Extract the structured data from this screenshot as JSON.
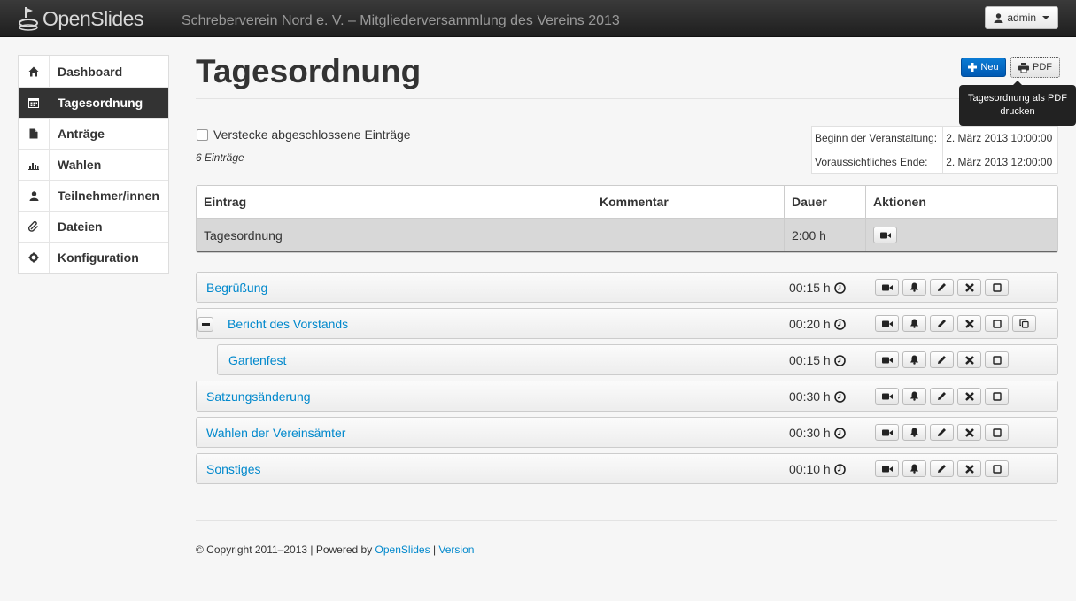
{
  "header": {
    "logo_text": "OpenSlides",
    "event_title": "Schreberverein Nord e. V. – Mitgliederversammlung des Vereins 2013",
    "user_label": "admin"
  },
  "sidebar": {
    "items": [
      {
        "label": "Dashboard",
        "icon": "home-icon"
      },
      {
        "label": "Tagesordnung",
        "icon": "calendar-icon",
        "active": true
      },
      {
        "label": "Anträge",
        "icon": "file-icon"
      },
      {
        "label": "Wahlen",
        "icon": "bar-chart-icon"
      },
      {
        "label": "Teilnehmer/innen",
        "icon": "user-icon"
      },
      {
        "label": "Dateien",
        "icon": "paperclip-icon"
      },
      {
        "label": "Konfiguration",
        "icon": "cog-icon"
      }
    ]
  },
  "main": {
    "title": "Tagesordnung",
    "new_button": "Neu",
    "pdf_button": "PDF",
    "pdf_tooltip": "Tagesordnung als PDF drucken",
    "hide_closed_label": "Verstecke abgeschlossene Einträge",
    "entry_count": "6 Einträge",
    "event_info": {
      "start_label": "Beginn der Veranstaltung:",
      "start_value": "2. März 2013 10:00:00",
      "end_label": "Voraussichtliches Ende:",
      "end_value": "2. März 2013 12:00:00"
    },
    "table": {
      "headers": [
        "Eintrag",
        "Kommentar",
        "Dauer",
        "Aktionen"
      ],
      "summary_row": {
        "entry": "Tagesordnung",
        "comment": "",
        "duration": "2:00 h"
      }
    },
    "items": [
      {
        "title": "Begrüßung",
        "duration": "00:15 h"
      },
      {
        "title": "Bericht des Vorstands",
        "duration": "00:20 h"
      },
      {
        "title": "Gartenfest",
        "duration": "00:15 h"
      },
      {
        "title": "Satzungsänderung",
        "duration": "00:30 h"
      },
      {
        "title": "Wahlen der Vereinsämter",
        "duration": "00:30 h"
      },
      {
        "title": "Sonstiges",
        "duration": "00:10 h"
      }
    ]
  },
  "footer": {
    "copyright": "© Copyright 2011–2013 | Powered by",
    "link_openslides": "OpenSlides",
    "separator": "|",
    "link_version": "Version"
  }
}
